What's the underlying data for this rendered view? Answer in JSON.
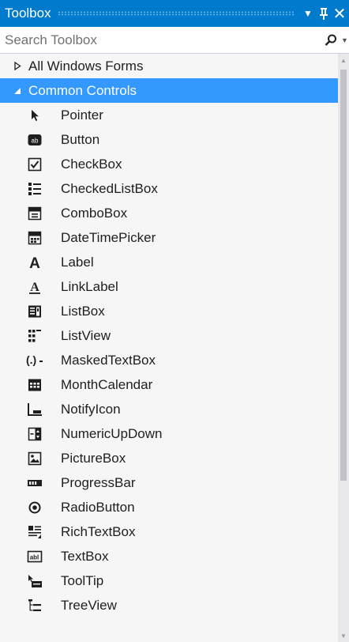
{
  "window": {
    "title": "Toolbox",
    "dropdown_glyph": "▾",
    "pin_glyph": "P",
    "close_glyph": "×"
  },
  "search": {
    "placeholder": "Search Toolbox",
    "value": ""
  },
  "colors": {
    "title_bar": "#007acc",
    "selected_row": "#3399ff",
    "panel_background": "#f6f6f6"
  },
  "groups": [
    {
      "label": "All Windows Forms",
      "expanded": false,
      "selected": false
    },
    {
      "label": "Common Controls",
      "expanded": true,
      "selected": true
    }
  ],
  "items": [
    {
      "label": "Pointer",
      "icon": "pointer-icon"
    },
    {
      "label": "Button",
      "icon": "button-icon"
    },
    {
      "label": "CheckBox",
      "icon": "checkbox-icon"
    },
    {
      "label": "CheckedListBox",
      "icon": "checkedlistbox-icon"
    },
    {
      "label": "ComboBox",
      "icon": "combobox-icon"
    },
    {
      "label": "DateTimePicker",
      "icon": "datetimepicker-icon"
    },
    {
      "label": "Label",
      "icon": "label-icon"
    },
    {
      "label": "LinkLabel",
      "icon": "linklabel-icon"
    },
    {
      "label": "ListBox",
      "icon": "listbox-icon"
    },
    {
      "label": "ListView",
      "icon": "listview-icon"
    },
    {
      "label": "MaskedTextBox",
      "icon": "maskedtextbox-icon"
    },
    {
      "label": "MonthCalendar",
      "icon": "monthcalendar-icon"
    },
    {
      "label": "NotifyIcon",
      "icon": "notifyicon-icon"
    },
    {
      "label": "NumericUpDown",
      "icon": "numericupdown-icon"
    },
    {
      "label": "PictureBox",
      "icon": "picturebox-icon"
    },
    {
      "label": "ProgressBar",
      "icon": "progressbar-icon"
    },
    {
      "label": "RadioButton",
      "icon": "radiobutton-icon"
    },
    {
      "label": "RichTextBox",
      "icon": "richtextbox-icon"
    },
    {
      "label": "TextBox",
      "icon": "textbox-icon"
    },
    {
      "label": "ToolTip",
      "icon": "tooltip-icon"
    },
    {
      "label": "TreeView",
      "icon": "treeview-icon"
    }
  ]
}
